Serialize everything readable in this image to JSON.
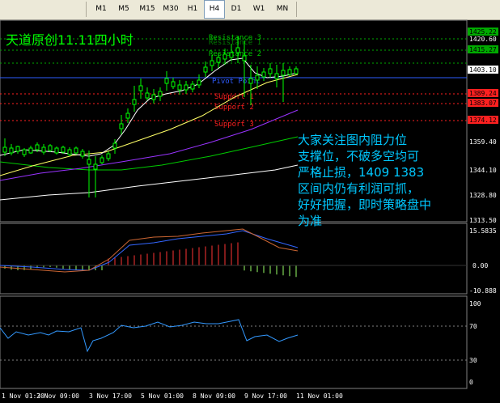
{
  "toolbar": {
    "timeframes": [
      "M1",
      "M5",
      "M15",
      "M30",
      "H1",
      "H4",
      "D1",
      "W1",
      "MN"
    ],
    "active": "H4"
  },
  "chart": {
    "title": "天道原创11.11四小时",
    "annotation_lines": [
      "大家关注图内阻力位",
      "支撑位，不破多空均可",
      "严格止损，1409 1383",
      "区间内仍有利润可抓，",
      "好好把握，即时策略盘中",
      "为准"
    ],
    "levels": [
      {
        "label": "Resistance 3",
        "color": "#00cc00"
      },
      {
        "label": "Resistance 2",
        "color": "#00cc00"
      },
      {
        "label": "Resistance 1",
        "color": "#00cc00"
      },
      {
        "label": "Pivot Point",
        "color": "#2e5bff"
      },
      {
        "label": "Support 1",
        "color": "#ff2020"
      },
      {
        "label": "Support 2",
        "color": "#ff2020"
      },
      {
        "label": "Support 3",
        "color": "#ff2020"
      }
    ],
    "price_axis": [
      "1425.22",
      "1420.60",
      "1415.27",
      "1403.10",
      "1389.24",
      "1383.07",
      "1374.12",
      "1359.40",
      "1344.10",
      "1328.80",
      "1313.50"
    ],
    "macd_axis": [
      "15.5835",
      "0.00",
      "-10.888"
    ],
    "rsi_axis": [
      "100",
      "70",
      "30",
      "0"
    ],
    "time_axis": [
      "1 Nov 01:30",
      "2 Nov 09:00",
      "3 Nov 17:00",
      "5 Nov 01:00",
      "8 Nov 09:00",
      "9 Nov 17:00",
      "11 Nov 01:00"
    ],
    "colors": {
      "bg": "#000000",
      "candle": "#00ff00",
      "ma_fast": "#ffffff",
      "ma_yellow": "#ffff66",
      "ma_purple": "#9933ff",
      "ma_green": "#00cc00",
      "ma_white_slow": "#ffffff",
      "macd_hist_pos": "#ff3333",
      "macd_hist_neg": "#99ff66",
      "macd_signal": "#3366ff",
      "macd_line": "#cc6633",
      "rsi": "#3399ff",
      "grid": "#808080"
    }
  }
}
